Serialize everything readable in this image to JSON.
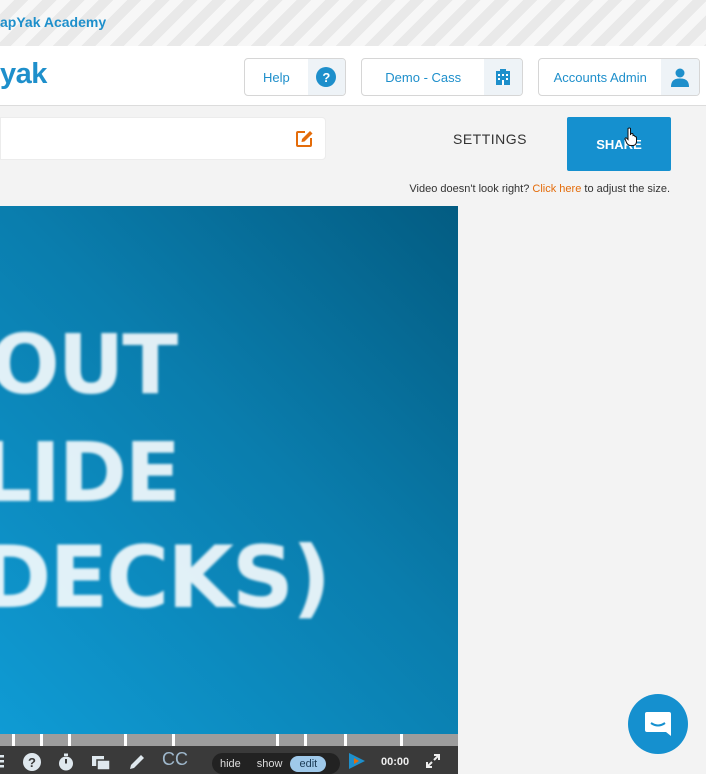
{
  "topbar": {
    "academy_link": "apYak Academy"
  },
  "header": {
    "logo_text": "yak",
    "help_label": "Help",
    "demo_label": "Demo - Cass",
    "account_label": "Accounts Admin"
  },
  "editor": {
    "title_value": "",
    "settings_tab": "SETTINGS",
    "share_button": "SHARE",
    "size_note_prefix": "Video doesn't look right?",
    "size_note_link": "Click here",
    "size_note_suffix": "to adjust the size."
  },
  "video": {
    "text_lines": [
      "OUT",
      "LIDE",
      "DECKS)"
    ],
    "brand_color": "#1590cf"
  },
  "controls": {
    "caption_label": "CC",
    "segment": [
      "hide",
      "show",
      "edit"
    ],
    "segment_active": "edit",
    "time": "00:00"
  },
  "colors": {
    "accent": "#1e8fcb",
    "link_orange": "#e46c0a"
  }
}
